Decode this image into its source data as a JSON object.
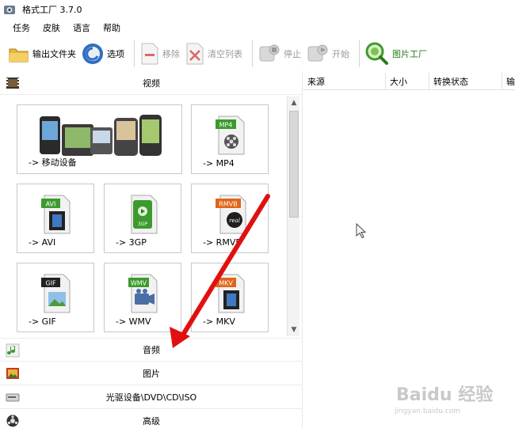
{
  "window": {
    "title": "格式工厂 3.7.0"
  },
  "menu": {
    "items": [
      "任务",
      "皮肤",
      "语言",
      "帮助"
    ]
  },
  "toolbar": {
    "output_folder": "输出文件夹",
    "options": "选项",
    "remove": "移除",
    "clear_list": "清空列表",
    "stop": "停止",
    "start": "开始",
    "picture_factory": "图片工厂"
  },
  "sidebar": {
    "video": "视频",
    "audio": "音频",
    "picture": "图片",
    "optical": "光驱设备\\DVD\\CD\\ISO",
    "advanced": "高级"
  },
  "tiles": {
    "mobile": {
      "label": "-> 移动设备"
    },
    "mp4": {
      "label": "-> MP4",
      "badge": "MP4"
    },
    "avi": {
      "label": "-> AVI",
      "badge": "AVI"
    },
    "3gp": {
      "label": "-> 3GP",
      "badge": "3GP"
    },
    "rmvb": {
      "label": "-> RMVB",
      "badge": "RMVB"
    },
    "gif": {
      "label": "-> GIF",
      "badge": "GIF"
    },
    "wmv": {
      "label": "-> WMV",
      "badge": "WMV"
    },
    "mkv": {
      "label": "-> MKV",
      "badge": "MKV"
    }
  },
  "table": {
    "columns": [
      "来源",
      "大小",
      "转换状态",
      "输"
    ]
  },
  "watermark": {
    "brand": "Baidu 经验",
    "url": "jingyan.baidu.com"
  },
  "colors": {
    "accent_red": "#e01010",
    "badge_green": "#3c9a2e",
    "badge_orange": "#e0661a"
  }
}
